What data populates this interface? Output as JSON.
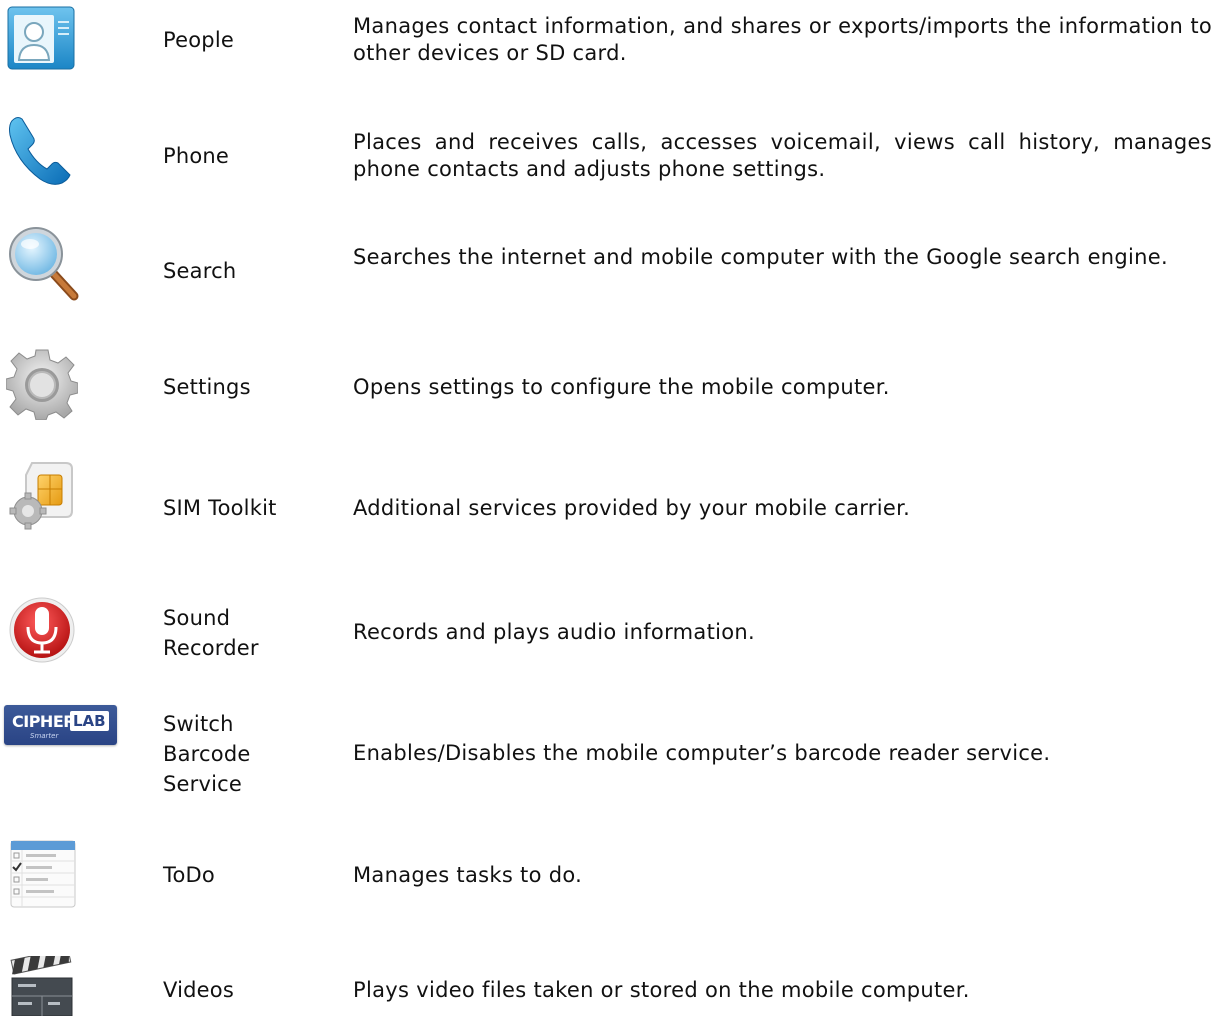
{
  "apps": [
    {
      "name": "People",
      "description": "Manages contact information, and shares or exports/imports the information to other devices or SD card.",
      "icon": "people-contacts-icon"
    },
    {
      "name": "Phone",
      "description": "Places and receives calls, accesses voicemail, views call history, manages phone contacts and adjusts phone settings.",
      "icon": "phone-handset-icon"
    },
    {
      "name": "Search",
      "description": "Searches the internet and mobile computer with the Google search engine.",
      "icon": "magnifier-icon"
    },
    {
      "name": "Settings",
      "description": "Opens settings to configure the mobile computer.",
      "icon": "gear-icon"
    },
    {
      "name": "SIM Toolkit",
      "description": "Additional services provided by your mobile carrier.",
      "icon": "sim-card-gear-icon"
    },
    {
      "name": "Sound Recorder",
      "description": "Records and plays audio information.",
      "icon": "microphone-icon"
    },
    {
      "name": "Switch Barcode Service",
      "description": "Enables/Disables the mobile computer’s barcode reader service.",
      "icon": "cipherlab-logo-icon",
      "logo_text": "CIPHERLAB Smarter"
    },
    {
      "name": "ToDo",
      "description": "Manages tasks to do.",
      "icon": "todo-checklist-icon"
    },
    {
      "name": "Videos",
      "description": "Plays video files taken or stored on the mobile computer.",
      "icon": "clapperboard-icon"
    }
  ]
}
